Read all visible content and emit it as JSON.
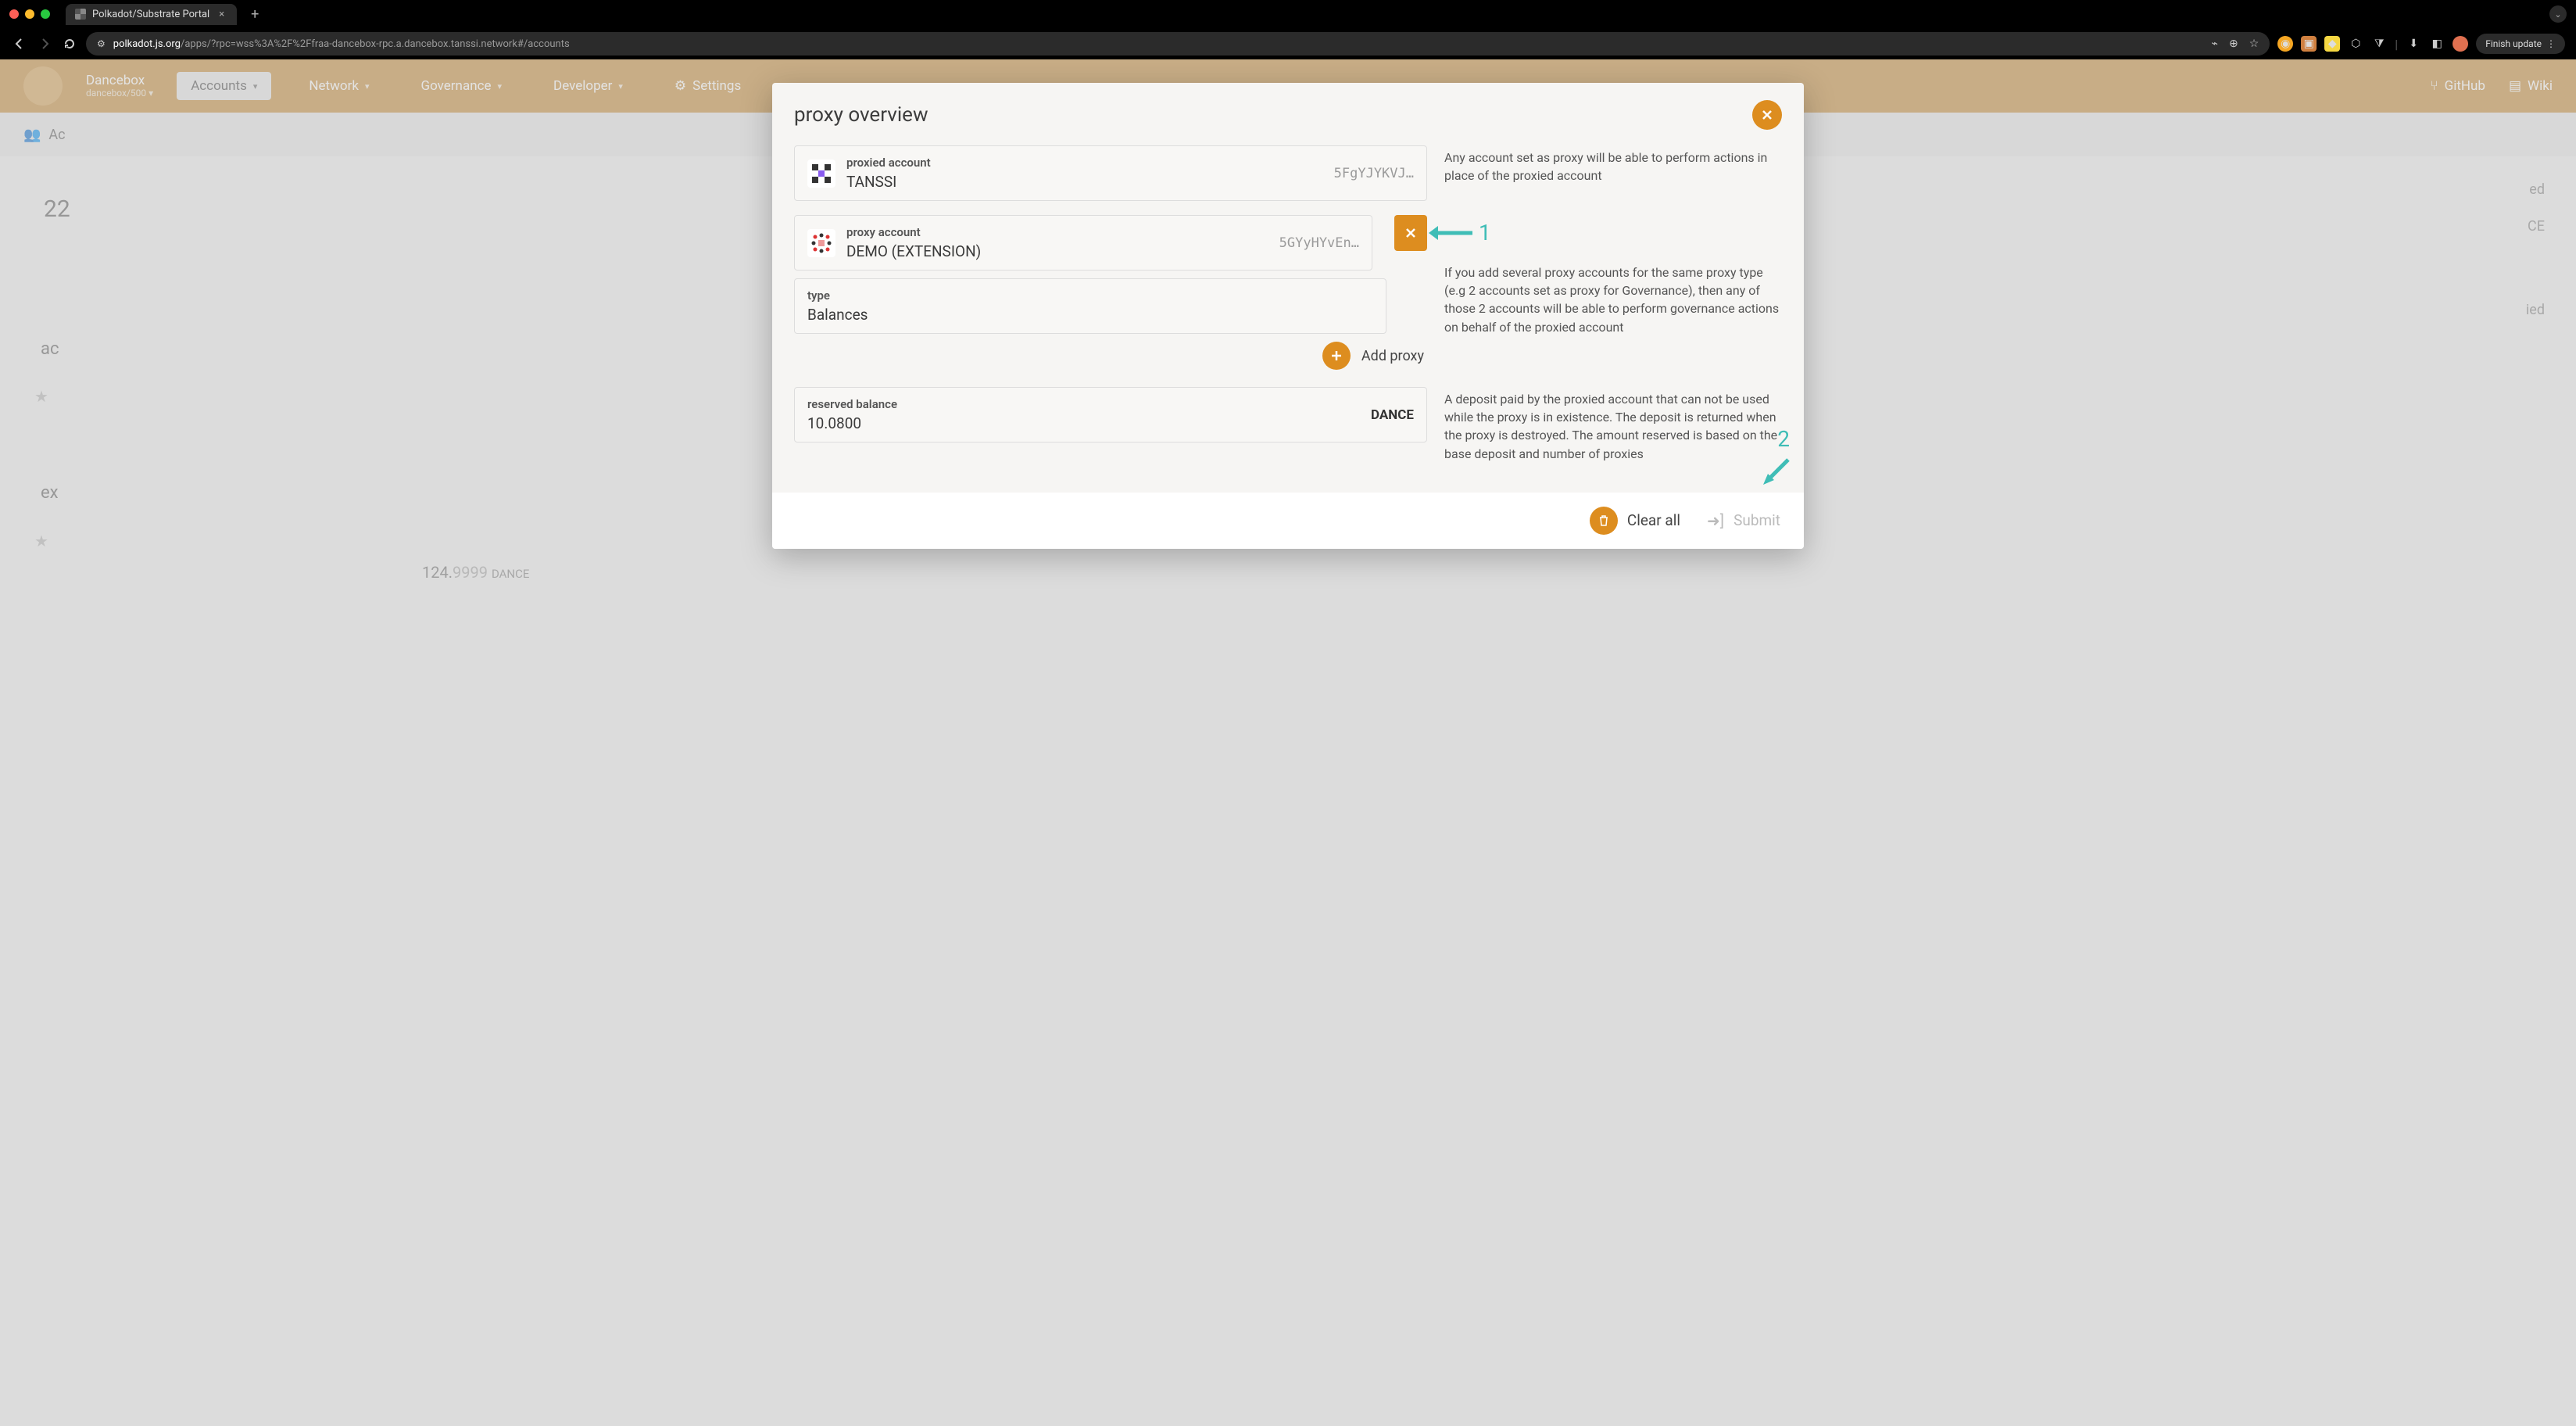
{
  "browser": {
    "tab_title": "Polkadot/Substrate Portal",
    "url_domain": "polkadot.js.org",
    "url_path": "/apps/?rpc=wss%3A%2F%2Ffraa-dancebox-rpc.a.dancebox.tanssi.network#/accounts",
    "finish_update": "Finish update"
  },
  "app_nav": {
    "network_name": "Dancebox",
    "network_sub": "dancebox/500",
    "tabs": {
      "accounts": "Accounts",
      "network": "Network",
      "governance": "Governance",
      "developer": "Developer",
      "settings": "Settings"
    },
    "github": "GitHub",
    "wiki": "Wiki"
  },
  "sub_bar": {
    "label_fragment": "Ac"
  },
  "modal": {
    "title": "proxy overview",
    "proxied": {
      "label": "proxied account",
      "name": "TANSSI",
      "addr": "5FgYJYKVJ…"
    },
    "help_proxied": "Any account set as proxy will be able to perform actions in place of the proxied account",
    "proxy": {
      "label": "proxy account",
      "name": "DEMO (EXTENSION)",
      "addr": "5GYyHYvEn…"
    },
    "type": {
      "label": "type",
      "value": "Balances"
    },
    "help_type": "If you add several proxy accounts for the same proxy type (e.g 2 accounts set as proxy for Governance), then any of those 2 accounts will be able to perform governance actions on behalf of the proxied account",
    "add_proxy": "Add proxy",
    "reserved": {
      "label": "reserved balance",
      "value": "10.0800",
      "unit": "DANCE"
    },
    "help_reserved": "A deposit paid by the proxied account that can not be used while the proxy is in existence. The deposit is returned when the proxy is destroyed. The amount reserved is based on the base deposit and number of proxies",
    "annot1": "1",
    "annot2": "2",
    "footer": {
      "clear_all": "Clear all",
      "submit": "Submit"
    }
  },
  "background": {
    "balance_int": "124.",
    "balance_dec": "9999",
    "balance_unit": "DANCE",
    "right_frag1": "ed",
    "right_frag2": "CE",
    "right_frag3": "ied",
    "left_num": "22",
    "left_ac": "ac",
    "left_ex": "ex"
  }
}
